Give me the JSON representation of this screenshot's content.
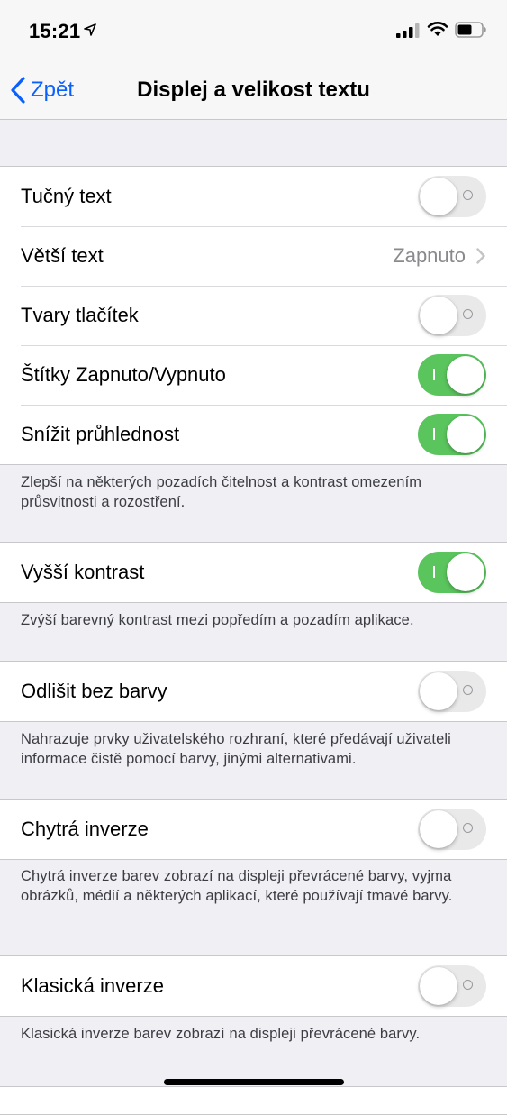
{
  "status": {
    "time": "15:21"
  },
  "nav": {
    "back_label": "Zpět",
    "title": "Displej a velikost textu"
  },
  "rows": {
    "bold_text": {
      "label": "Tučný text",
      "on": false
    },
    "larger_text": {
      "label": "Větší text",
      "value": "Zapnuto"
    },
    "button_shapes": {
      "label": "Tvary tlačítek",
      "on": false
    },
    "on_off_labels": {
      "label": "Štítky Zapnuto/Vypnuto",
      "on": true
    },
    "reduce_transparency": {
      "label": "Snížit průhlednost",
      "on": true
    },
    "increase_contrast": {
      "label": "Vyšší kontrast",
      "on": true
    },
    "differentiate_color": {
      "label": "Odlišit bez barvy",
      "on": false
    },
    "smart_invert": {
      "label": "Chytrá inverze",
      "on": false
    },
    "classic_invert": {
      "label": "Klasická inverze",
      "on": false
    }
  },
  "footers": {
    "transparency": "Zlepší na některých pozadích čitelnost a kontrast omezením průsvitnosti a rozostření.",
    "contrast": "Zvýší barevný kontrast mezi popředím a pozadím aplikace.",
    "differentiate": "Nahrazuje prvky uživatelského rozhraní, které předávají uživateli informace čistě pomocí barvy, jinými alternativami.",
    "smart_invert": "Chytrá inverze barev zobrazí na displeji převrácené barvy, vyjma obrázků, médií a některých aplikací, které používají tmavé barvy.",
    "classic_invert": "Klasická inverze barev zobrazí na displeji převrácené barvy."
  },
  "colors": {
    "accent": "#0a60fe",
    "toggle_on": "#5ac45d",
    "toggle_off": "#e9e9ea"
  }
}
